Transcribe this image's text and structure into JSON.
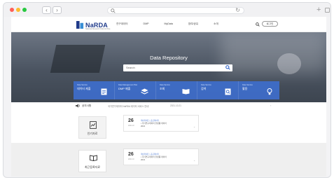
{
  "browser": {
    "back_glyph": "‹",
    "forward_glyph": "›",
    "reload_glyph": "↻",
    "newtab_glyph": "+"
  },
  "header": {
    "logo": "NaRDA",
    "logo_sub": "National Research Data Archive",
    "nav": [
      "연구데이터",
      "DMP",
      "MyData",
      "참여/공유",
      "소개"
    ],
    "login": "로그인"
  },
  "hero": {
    "title": "Data Repository",
    "search_placeholder": "Search",
    "services": [
      {
        "en": "Data Service",
        "ko": "데이터 제출",
        "icon": "document-icon"
      },
      {
        "en": "Data Management Plan",
        "ko": "DMP 제출",
        "icon": "layers-icon"
      },
      {
        "en": "Data Service",
        "ko": "조회",
        "icon": "book-icon"
      },
      {
        "en": "Data Service",
        "ko": "검색",
        "icon": "search-doc-icon"
      },
      {
        "en": "Data Service",
        "ko": "활용",
        "icon": "lightbulb-icon"
      }
    ]
  },
  "notice": {
    "label": "공지사항",
    "text": "국가연구데이터 NaRDA 데이터 서비스 안내",
    "date": "2021.10.21",
    "arrow": "›"
  },
  "sections": [
    {
      "category": "인기자료",
      "icon": "trending-doc-icon",
      "item": {
        "day": "26",
        "month": "2021.10",
        "meta": "데이터세트 | 공공데이터",
        "line1": "• 국가연구데이터 플랫폼 데이터",
        "line2": "2021",
        "more": "⌄"
      }
    },
    {
      "category": "최근등록자료",
      "icon": "book-open-icon",
      "item": {
        "day": "26",
        "month": "2021.10",
        "meta": "데이터세트 | 공공데이터",
        "line1": "• 국가연구데이터 플랫폼 데이터",
        "line2": "2021",
        "more": "⌄"
      }
    }
  ],
  "colors": {
    "brand": "#1f3a8a",
    "service_bar": "#3e6ecc",
    "hero_bg": "#4a5360"
  }
}
